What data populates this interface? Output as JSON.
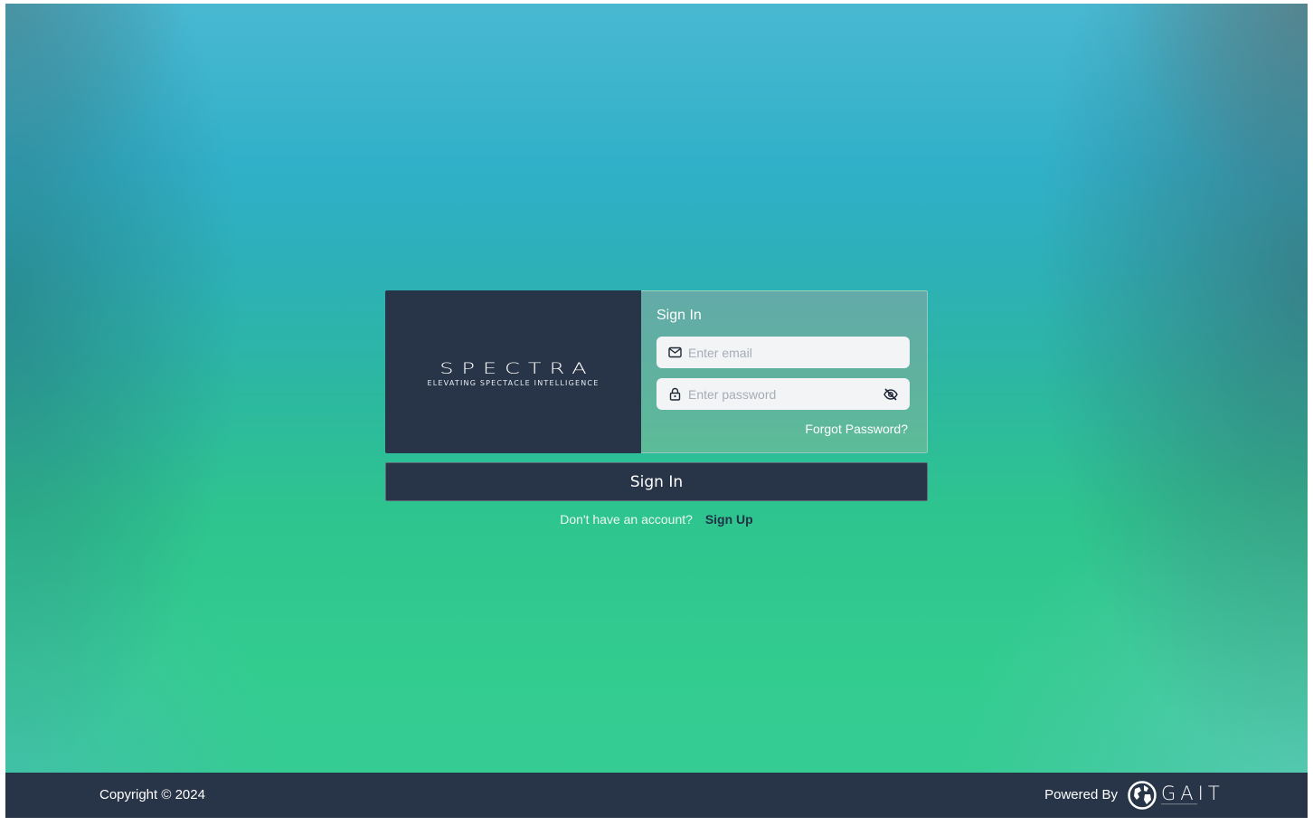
{
  "brand": {
    "wordmark": "SPECTRA",
    "tagline": "ELEVATING  SPECTACLE  INTELLIGENCE"
  },
  "form": {
    "title": "Sign In",
    "email": {
      "placeholder": "Enter email",
      "value": "",
      "icon": "mail-icon"
    },
    "password": {
      "placeholder": "Enter password",
      "value": "",
      "icon": "lock-icon",
      "toggle_icon": "eye-off-icon"
    },
    "forgot_label": "Forgot Password?"
  },
  "submit_label": "Sign In",
  "signup": {
    "question": "Don't have an account?",
    "link_label": "Sign Up"
  },
  "footer": {
    "copyright": "Copyright © 2024",
    "powered_by": "Powered By",
    "logo_text": "GAIT"
  },
  "colors": {
    "dark_navy": "#283447",
    "gradient_top": "#49b8d1",
    "gradient_bottom": "#36cb95",
    "field_background": "#f3f4f6"
  }
}
